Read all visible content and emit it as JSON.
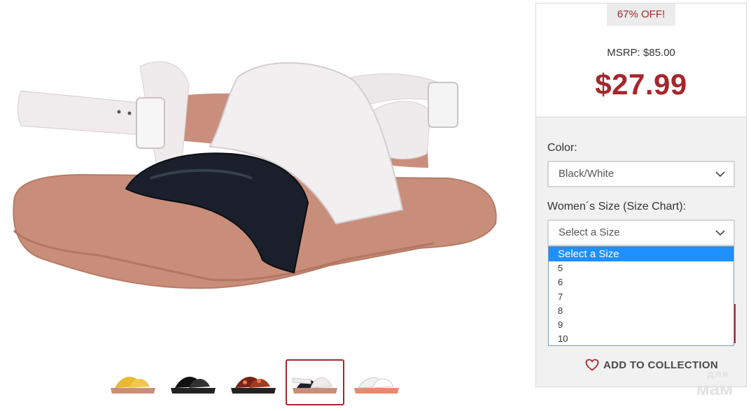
{
  "product": {
    "main_image_icon": "white-black-sandal-image",
    "thumbnails": [
      {
        "icon": "yellow-sandal-thumbnail",
        "active": false
      },
      {
        "icon": "black-sandal-thumbnail",
        "active": false
      },
      {
        "icon": "tortoise-sandal-thumbnail",
        "active": false
      },
      {
        "icon": "black-white-sandal-thumbnail",
        "active": true
      },
      {
        "icon": "white-sandal-thumbnail",
        "active": false
      }
    ]
  },
  "pricing": {
    "discount_badge": "67% OFF!",
    "msrp": "MSRP: $85.00",
    "price": "$27.99"
  },
  "options": {
    "color_label": "Color:",
    "color_value": "Black/White",
    "size_label": "Women´s Size (Size Chart):",
    "size_value": "Select a Size",
    "size_options": [
      "Select a Size",
      "5",
      "6",
      "7",
      "8",
      "9",
      "10"
    ],
    "size_selected_index": 0
  },
  "actions": {
    "add_to_collection": "ADD TO COLLECTION"
  },
  "watermark": {
    "line1": "для",
    "line2": "мам"
  },
  "colors": {
    "accent": "#a3282e",
    "dropdown_highlight": "#1e90ff",
    "panel_bg": "#f1f1f1"
  }
}
